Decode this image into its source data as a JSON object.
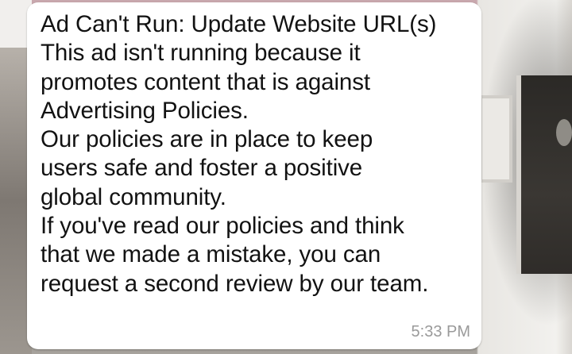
{
  "message": {
    "lines": [
      "Ad Can't Run: Update Website URL(s)",
      "This ad isn't running because it",
      "promotes content that is against",
      "Advertising Policies.",
      "Our policies are in place to keep",
      "users safe and foster a positive",
      "global community.",
      "If you've read our policies and think",
      "that we made a mistake, you can",
      "request a second review by our team."
    ],
    "time": "5:33 PM"
  },
  "colors": {
    "bubble": "#ffffff",
    "text": "#121212",
    "timestamp": "#9a9a9a"
  }
}
